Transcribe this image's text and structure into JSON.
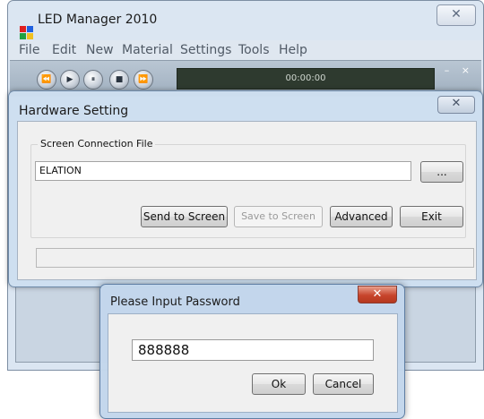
{
  "main_window": {
    "title": "LED Manager 2010",
    "close_glyph": "✕",
    "logo_colors": [
      "#e02020",
      "#2060e0",
      "#20a040",
      "#f0c020"
    ],
    "menu": [
      "File",
      "Edit",
      "New",
      "Material",
      "Settings",
      "Tools",
      "Help"
    ],
    "player": {
      "buttons": [
        {
          "name": "rewind-icon",
          "glyph": "⏪"
        },
        {
          "name": "play-icon",
          "glyph": "▶"
        },
        {
          "name": "pause-icon",
          "glyph": "⏸"
        },
        {
          "name": "stop-icon",
          "glyph": "■"
        },
        {
          "name": "fast-forward-icon",
          "glyph": "⏩"
        }
      ],
      "time": "00:00:00",
      "minmax": "– ×"
    }
  },
  "hardware_dialog": {
    "title": "Hardware Setting",
    "close_glyph": "✕",
    "group_label": "Screen Connection File",
    "connection_file": "ELATION",
    "browse_label": "...",
    "buttons": {
      "send": "Send to Screen",
      "save": "Save to Screen",
      "advanced": "Advanced",
      "exit": "Exit"
    },
    "status_text": ""
  },
  "password_dialog": {
    "title": "Please Input Password",
    "close_glyph": "✕",
    "password": "888888",
    "ok_label": "Ok",
    "cancel_label": "Cancel"
  }
}
